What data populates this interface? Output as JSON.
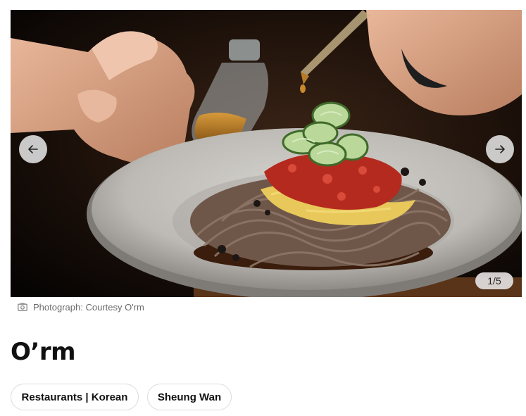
{
  "carousel": {
    "counter": "1/5",
    "prev_icon": "arrow-left-icon",
    "next_icon": "arrow-right-icon"
  },
  "caption": {
    "icon": "camera-icon",
    "text": "Photograph: Courtesy O'rm"
  },
  "venue": {
    "title": "O’rm"
  },
  "tags": [
    {
      "label": "Restaurants | Korean"
    },
    {
      "label": "Sheung Wan"
    }
  ],
  "colors": {
    "nav_button_bg": "#e4e4e4",
    "tag_border": "#dcdcdc",
    "caption_text": "#6b6b6b"
  }
}
